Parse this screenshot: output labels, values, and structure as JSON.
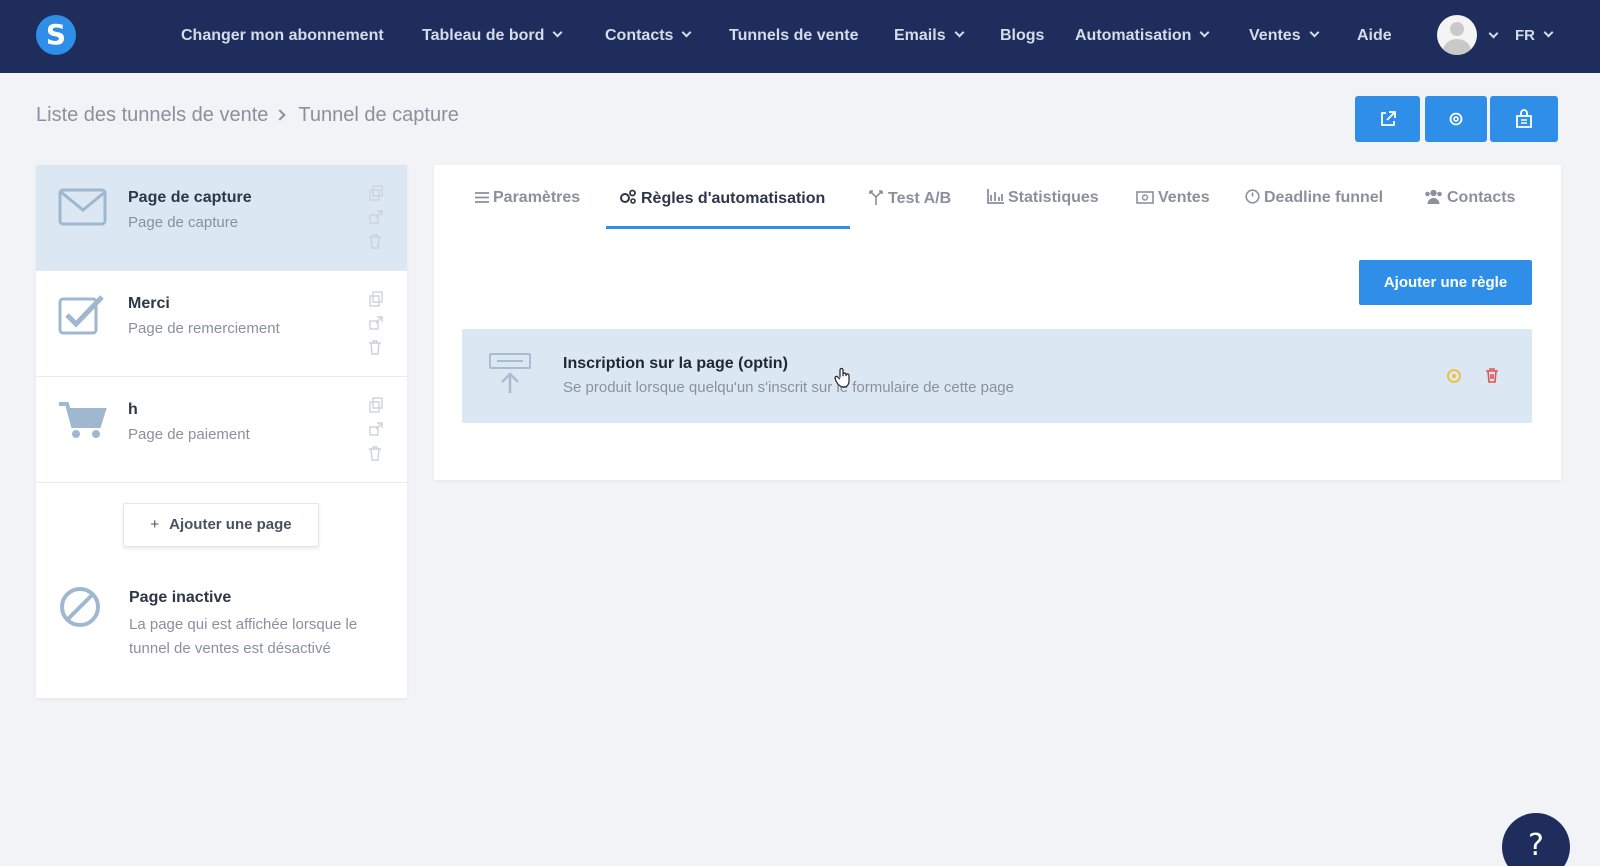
{
  "app": {
    "logo_letter": "S",
    "brand_color": "#2f8fe8",
    "nav_bg": "#1e2d5c"
  },
  "nav": {
    "items": [
      {
        "label": "Changer mon abonnement",
        "dropdown": false
      },
      {
        "label": "Tableau de bord",
        "dropdown": true
      },
      {
        "label": "Contacts",
        "dropdown": true
      },
      {
        "label": "Tunnels de vente",
        "dropdown": false
      },
      {
        "label": "Emails",
        "dropdown": true
      },
      {
        "label": "Blogs",
        "dropdown": false
      },
      {
        "label": "Automatisation",
        "dropdown": true
      },
      {
        "label": "Ventes",
        "dropdown": true
      },
      {
        "label": "Aide",
        "dropdown": false
      }
    ],
    "language": "FR"
  },
  "breadcrumb": {
    "parent": "Liste des tunnels de vente",
    "current": "Tunnel de capture"
  },
  "toolbar": {
    "buttons": [
      "external-link-icon",
      "settings-icon",
      "store-icon"
    ]
  },
  "pages": [
    {
      "title": "Page de capture",
      "subtitle": "Page de capture",
      "icon": "envelope-icon",
      "active": true
    },
    {
      "title": "Merci",
      "subtitle": "Page de remerciement",
      "icon": "checkbox-icon",
      "active": false
    },
    {
      "title": "h",
      "subtitle": "Page de paiement",
      "icon": "cart-icon",
      "active": false
    }
  ],
  "add_page_label": "Ajouter une page",
  "inactive_page": {
    "title": "Page inactive",
    "description": "La page qui est affichée lorsque le tunnel de ventes est désactivé"
  },
  "tabs": [
    {
      "label": "Paramètres",
      "icon": "list-icon",
      "active": false
    },
    {
      "label": "Règles d'automatisation",
      "icon": "gears-icon",
      "active": true
    },
    {
      "label": "Test A/B",
      "icon": "split-icon",
      "active": false
    },
    {
      "label": "Statistiques",
      "icon": "bar-chart-icon",
      "active": false
    },
    {
      "label": "Ventes",
      "icon": "money-icon",
      "active": false
    },
    {
      "label": "Deadline funnel",
      "icon": "clock-icon",
      "active": false
    },
    {
      "label": "Contacts",
      "icon": "users-icon",
      "active": false
    }
  ],
  "add_rule_label": "Ajouter une règle",
  "rule": {
    "title": "Inscription sur la page (optin)",
    "description": "Se produit lorsque quelqu'un s'inscrit sur le formulaire de cette page"
  },
  "help_label": "?"
}
